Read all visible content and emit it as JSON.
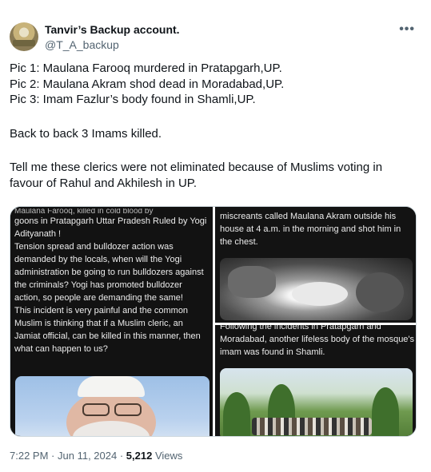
{
  "author": {
    "display_name": "Tanvir’s Backup account.",
    "handle": "@T_A_backup",
    "more_icon": "more-horizontal-icon"
  },
  "tweet": {
    "lines": [
      "Pic 1: Maulana Farooq murdered in Pratapgarh,UP.",
      "Pic 2: Maulana Akram shod dead in Moradabad,UP.",
      "Pic 3: Imam Fazlur’s body found in Shamli,UP.",
      "Back to back 3 Imams killed.",
      "Tell me these clerics were not eliminated because of Muslims voting in favour of Rahul and Akhilesh in UP."
    ]
  },
  "media": {
    "pic1": {
      "cut_line": "Maulana Farooq, killed in cold blood by",
      "text": "goons in Pratapgarh Uttar Pradesh Ruled by Yogi Adityanath !\n Tension spread and bulldozer action was demanded by the locals, when will the Yogi administration be going to run bulldozers against the criminals? Yogi has promoted bulldozer action, so people are demanding the same!\n This incident is very painful and the common Muslim is thinking that if a Muslim cleric, an Jamiat official, can be killed in this manner, then what can happen to us?"
    },
    "pic2": {
      "text": "miscreants called Maulana Akram outside his house at 4 a.m. in the morning and shot him in the chest."
    },
    "pic3": {
      "text": "Following the incidents in Pratapgarh and Moradabad, another lifeless body of the mosque's imam was found in Shamli."
    }
  },
  "meta": {
    "time": "7:22 PM",
    "date": "Jun 11, 2024",
    "views_count": "5,212",
    "views_label": "Views"
  }
}
